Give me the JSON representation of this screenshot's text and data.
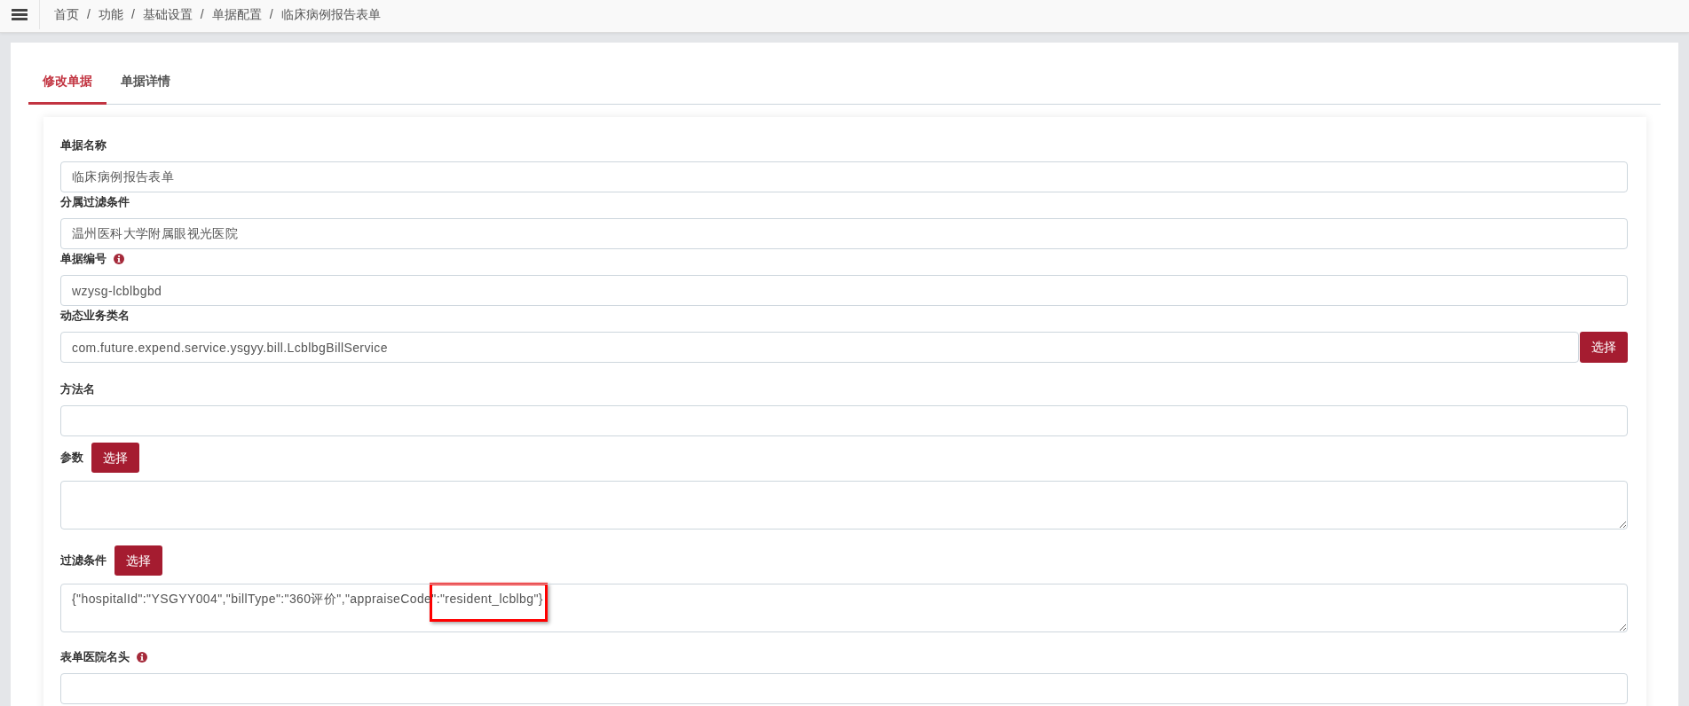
{
  "breadcrumb": [
    {
      "kind": "link",
      "text": "首页"
    },
    {
      "kind": "separator",
      "text": "/"
    },
    {
      "kind": "link",
      "text": "功能"
    },
    {
      "kind": "separator",
      "text": "/"
    },
    {
      "kind": "link",
      "text": "基础设置"
    },
    {
      "kind": "separator",
      "text": "/"
    },
    {
      "kind": "link",
      "text": "单据配置"
    },
    {
      "kind": "separator",
      "text": "/"
    },
    {
      "kind": "current",
      "text": "临床病例报告表单"
    }
  ],
  "tabs": [
    {
      "label": "修改单据",
      "selected": true
    },
    {
      "label": "单据详情",
      "selected": false
    }
  ],
  "fields": [
    {
      "kind": "text",
      "label": "单据名称",
      "info": false,
      "highlighted": false,
      "value": "临床病例报告表单"
    },
    {
      "kind": "text",
      "label": "分属过滤条件",
      "info": false,
      "highlighted": false,
      "value": "温州医科大学附属眼视光医院"
    },
    {
      "kind": "text",
      "label": "单据编号",
      "info": true,
      "highlighted": false,
      "value": "wzysg-lcblbgbd"
    },
    {
      "kind": "text",
      "label": "动态业务类名",
      "info": false,
      "highlighted": false,
      "value": "com.future.expend.service.ysgyy.bill.LcblbgBillService",
      "button": "选择"
    },
    {
      "kind": "text",
      "label": "方法名",
      "info": false,
      "highlighted": false
    },
    {
      "kind": "textarea",
      "label": "参数",
      "info": false,
      "highlighted": false,
      "label_button": "选择"
    },
    {
      "kind": "textarea",
      "label": "过滤条件",
      "info": false,
      "highlighted": true,
      "label_button": "选择",
      "value": "{\"hospitalId\":\"YSGYY004\",\"billType\":\"360评价\",\"appraiseCode\":\"resident_lcblbg\"}"
    },
    {
      "kind": "text",
      "label": "表单医院名头",
      "info": true,
      "highlighted": false
    }
  ]
}
